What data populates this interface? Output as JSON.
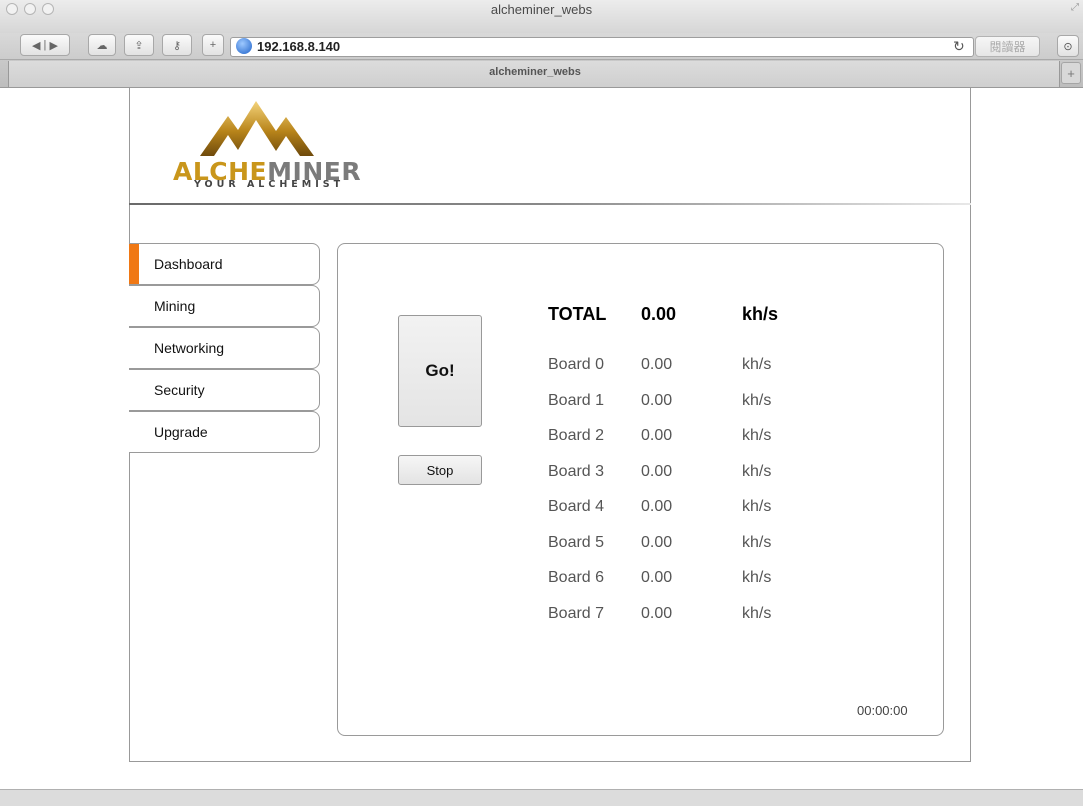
{
  "window": {
    "title": "alcheminer_webs",
    "url": "192.168.8.140",
    "reader_label": "閱讀器",
    "tab_title": "alcheminer_webs"
  },
  "brand": {
    "wordmark_gold": "ALCHE",
    "wordmark_silver": "MINER",
    "tagline": "YOUR ALCHEMIST",
    "gold_color": "#c9961b",
    "accent_color": "#f07814"
  },
  "sidebar": {
    "items": [
      {
        "label": "Dashboard",
        "active": true
      },
      {
        "label": "Mining",
        "active": false
      },
      {
        "label": "Networking",
        "active": false
      },
      {
        "label": "Security",
        "active": false
      },
      {
        "label": "Upgrade",
        "active": false
      }
    ]
  },
  "controls": {
    "go_label": "Go!",
    "stop_label": "Stop"
  },
  "hashrate": {
    "total": {
      "label": "TOTAL",
      "value": "0.00",
      "unit": "kh/s"
    },
    "boards": [
      {
        "label": "Board 0",
        "value": "0.00",
        "unit": "kh/s"
      },
      {
        "label": "Board 1",
        "value": "0.00",
        "unit": "kh/s"
      },
      {
        "label": "Board 2",
        "value": "0.00",
        "unit": "kh/s"
      },
      {
        "label": "Board 3",
        "value": "0.00",
        "unit": "kh/s"
      },
      {
        "label": "Board 4",
        "value": "0.00",
        "unit": "kh/s"
      },
      {
        "label": "Board 5",
        "value": "0.00",
        "unit": "kh/s"
      },
      {
        "label": "Board 6",
        "value": "0.00",
        "unit": "kh/s"
      },
      {
        "label": "Board 7",
        "value": "0.00",
        "unit": "kh/s"
      }
    ]
  },
  "uptime": "00:00:00"
}
